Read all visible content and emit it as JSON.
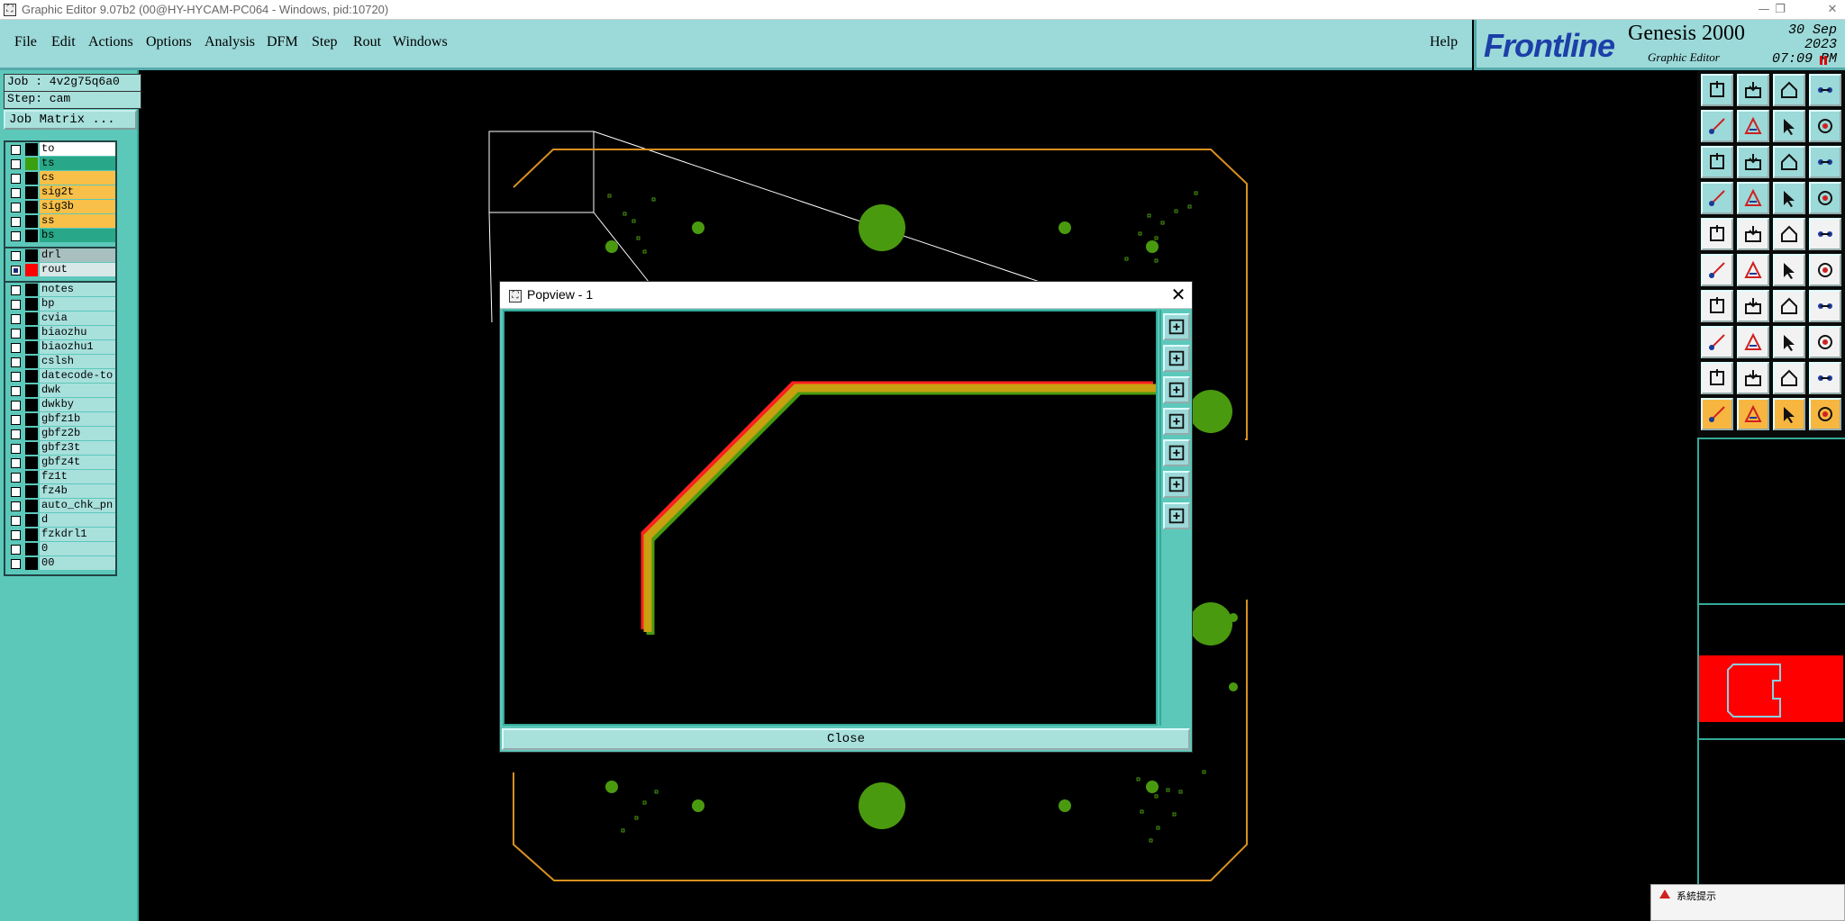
{
  "window": {
    "title": "Graphic Editor 9.07b2 (00@HY-HYCAM-PC064 - Windows, pid:10720)",
    "minimize_glyph": "—",
    "restore_glyph": "❐",
    "close_glyph": "✕"
  },
  "menu": {
    "file": "File",
    "edit": "Edit",
    "actions": "Actions",
    "options": "Options",
    "analysis": "Analysis",
    "dfm": "DFM",
    "step": "Step",
    "rout": "Rout",
    "windows": "Windows",
    "help": "Help"
  },
  "brand": {
    "frontline": "Frontline",
    "product": "Genesis 2000",
    "subtitle": "Graphic Editor",
    "date": "30 Sep 2023",
    "time": "07:09 PM"
  },
  "job": {
    "job_line": "Job : 4v2g75q6a0",
    "step_line": "Step: cam",
    "matrix_button": "Job Matrix ..."
  },
  "layers_board": [
    {
      "name": "to",
      "color": "#000000",
      "style": "white"
    },
    {
      "name": "ts",
      "color": "#3aa010",
      "style": "green"
    },
    {
      "name": "cs",
      "color": "#000000",
      "style": "orange"
    },
    {
      "name": "sig2t",
      "color": "#000000",
      "style": "orange"
    },
    {
      "name": "sig3b",
      "color": "#000000",
      "style": "orange"
    },
    {
      "name": "ss",
      "color": "#000000",
      "style": "orange"
    },
    {
      "name": "bs",
      "color": "#000000",
      "style": "green"
    }
  ],
  "layers_drill": [
    {
      "name": "drl",
      "color": "#000000",
      "style": "gray",
      "checked": false
    },
    {
      "name": "rout",
      "color": "#ff0000",
      "style": "light",
      "checked": true
    }
  ],
  "layers_misc": [
    "notes",
    "bp",
    "cvia",
    "biaozhu",
    "biaozhu1",
    "cslsh",
    "datecode-to",
    "dwk",
    "dwkby",
    "gbfz1b",
    "gbfz2b",
    "gbfz3t",
    "gbfz4t",
    "fz1t",
    "fz4b",
    "auto_chk_pn.",
    "d",
    "fzkdrl1",
    "0",
    "00"
  ],
  "popview": {
    "title": "Popview - 1",
    "close_x": "✕",
    "close_label": "Close"
  },
  "system_message": {
    "title": "系統提示"
  },
  "colors": {
    "panel": "#5cc8ba",
    "menubar": "#9cd9d9",
    "board_outline": "#d89020",
    "pad_green": "#4a9a10",
    "trace_yellow": "#c8a010",
    "trace_red": "#ff2020",
    "minimap_red": "#ff0000"
  },
  "tool_icons": [
    "open-job-icon",
    "save-job-icon",
    "home-icon",
    "layout-icon",
    "move-left-icon",
    "move-right-icon",
    "swap-icon",
    "redraw-icon",
    "zoom-fit-icon",
    "zoom-home-icon",
    "scale-icon",
    "help-icon",
    "measure-icon",
    "snap-icon",
    "net-icon",
    "route-icon",
    "pad-icon",
    "cut-icon",
    "line-icon",
    "fill-icon",
    "connect-icon",
    "cross-icon",
    "arc-icon",
    "link-icon",
    "angle-icon",
    "slash-icon",
    "rotate-icon",
    "split-icon",
    "select-icon",
    "minus-icon",
    "frame-icon",
    "group-icon",
    "triangle-1-icon",
    "triangle-2-icon",
    "triangle-3-icon",
    "triangle-4-icon",
    "pointer-1-icon",
    "pointer-2-icon",
    "pointer-3-icon",
    "pointer-4-icon"
  ]
}
